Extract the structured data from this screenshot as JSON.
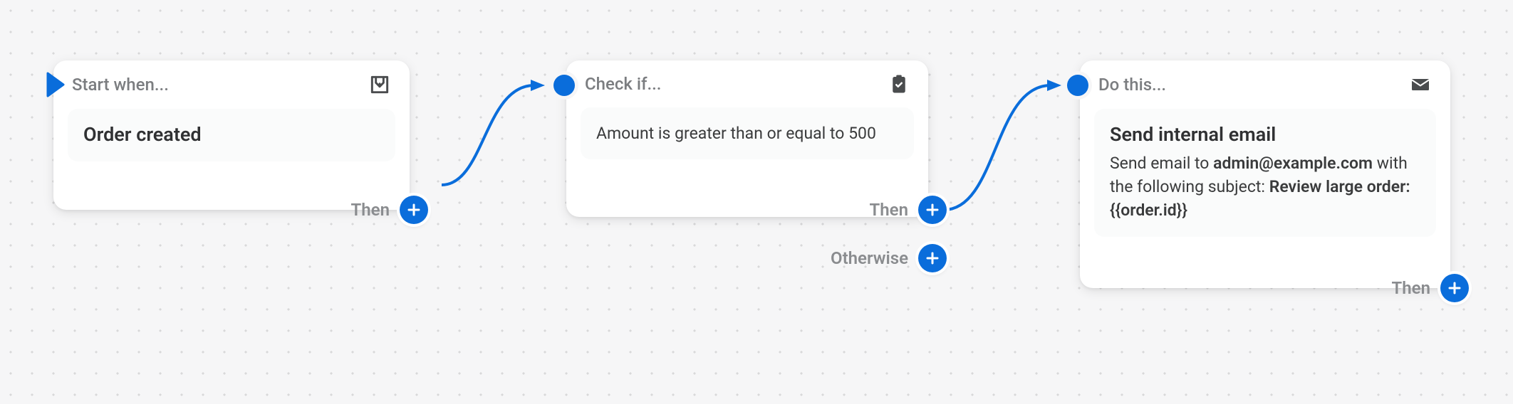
{
  "colors": {
    "accent": "#0a6ddb",
    "muted": "#8a8c8f"
  },
  "nodes": {
    "trigger": {
      "header_label": "Start when...",
      "icon": "inbox-icon",
      "title": "Order created",
      "branches": [
        {
          "label": "Then"
        }
      ]
    },
    "condition": {
      "header_label": "Check if...",
      "icon": "clipboard-check-icon",
      "description_plain": "Amount is greater than or equal to 500",
      "branches": [
        {
          "label": "Then"
        },
        {
          "label": "Otherwise"
        }
      ]
    },
    "action": {
      "header_label": "Do this...",
      "icon": "mail-icon",
      "title": "Send internal email",
      "description_prefix": "Send email to ",
      "email": "admin@example.com",
      "description_mid": " with the following subject: ",
      "subject": "Review large order: {{order.id}}",
      "branches": [
        {
          "label": "Then"
        }
      ]
    }
  }
}
